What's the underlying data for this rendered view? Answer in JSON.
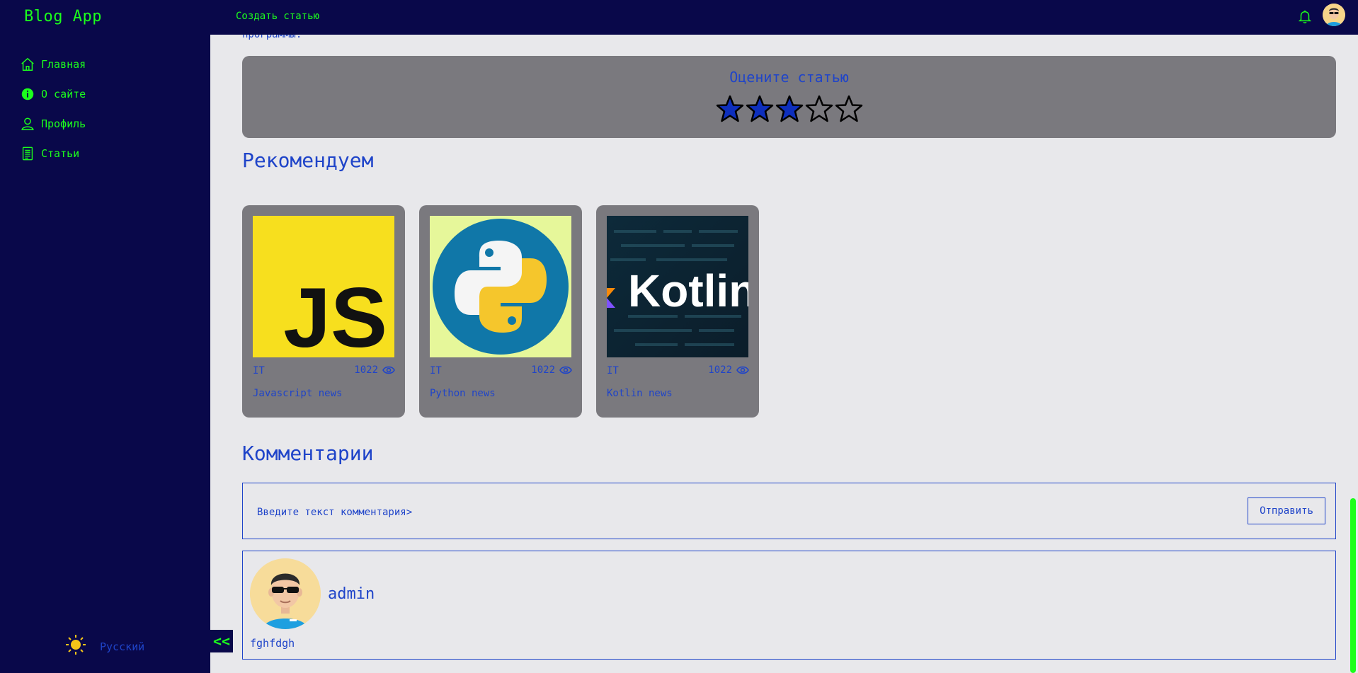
{
  "navbar": {
    "logo": "Blog App",
    "create_article": "Создать статью",
    "bell_icon": "bell-icon",
    "avatar_icon": "avatar"
  },
  "sidebar": {
    "items": [
      {
        "label": "Главная",
        "icon": "home-icon"
      },
      {
        "label": "О сайте",
        "icon": "info-icon"
      },
      {
        "label": "Профиль",
        "icon": "user-icon"
      },
      {
        "label": "Статьи",
        "icon": "document-icon"
      }
    ],
    "theme_icon": "sun-icon",
    "language": "Русский",
    "collapse_label": "<<"
  },
  "article": {
    "cut_text": "программы."
  },
  "rating": {
    "title": "Оцените статью",
    "value": 3,
    "max": 5
  },
  "recommend": {
    "title": "Рекомендуем",
    "cards": [
      {
        "type": "IT",
        "views": "1022",
        "title": "Javascript news",
        "image": "js-logo"
      },
      {
        "type": "IT",
        "views": "1022",
        "title": "Python news",
        "image": "python-logo"
      },
      {
        "type": "IT",
        "views": "1022",
        "title": "Kotlin news",
        "image": "kotlin-logo"
      }
    ]
  },
  "comments": {
    "title": "Комментарии",
    "placeholder": "Введите текст комментария>",
    "send_label": "Отправить",
    "items": [
      {
        "username": "admin",
        "text": "fghfdgh"
      }
    ]
  },
  "colors": {
    "nav_bg": "#09084a",
    "accent_green": "#1cff1c",
    "primary_blue": "#1f44c9",
    "card_bg": "#7a797e",
    "page_bg": "#e8e8eb"
  }
}
